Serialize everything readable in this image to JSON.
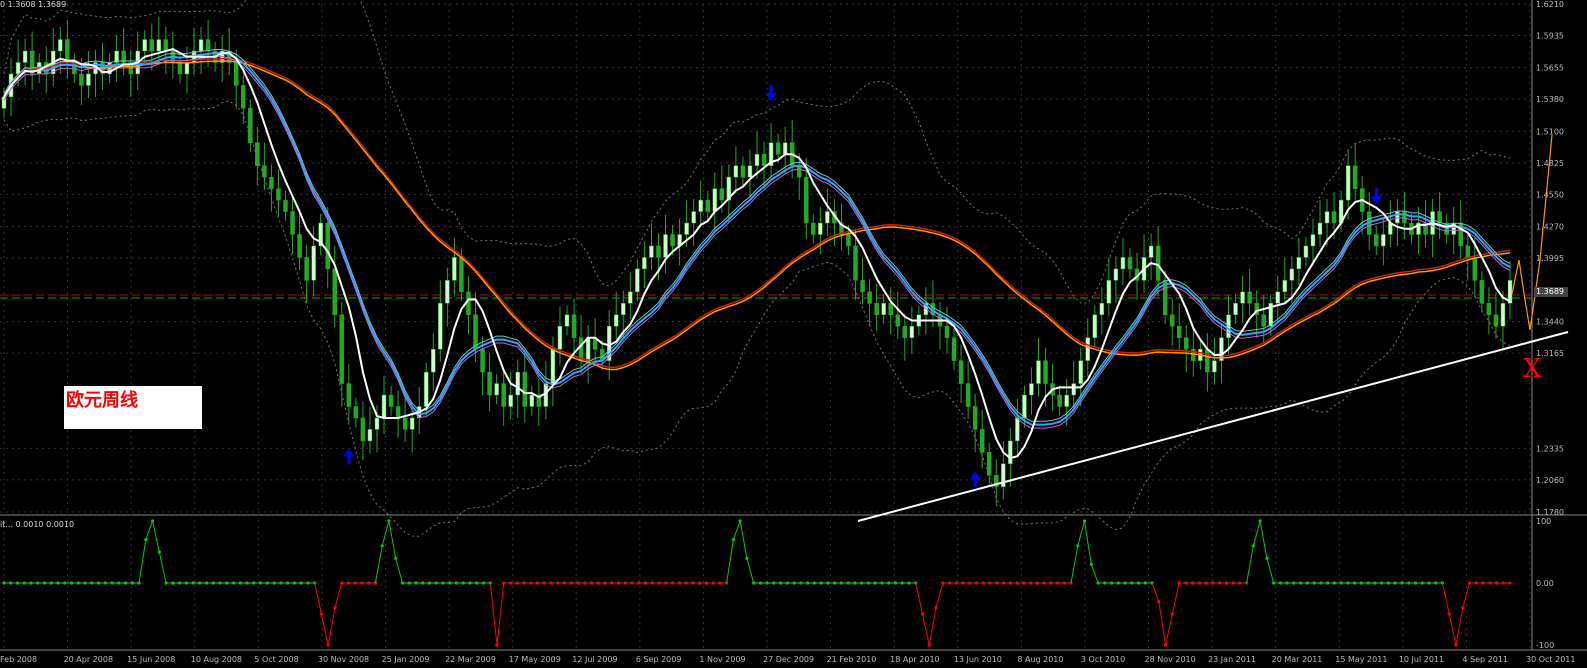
{
  "main_info": "0 1.3608 1.3689",
  "sub_info": "it... 0.0010 0.0010",
  "annotation_label": "欧元周线",
  "reversal_mark": "X",
  "current_price": "1.3689",
  "colors": {
    "background": "#000000",
    "candle_up": "#ccffcc",
    "candle_down": "#22aa22",
    "white_line": "#ffffff",
    "blue_line": "#3aa0ff",
    "orange_line": "#ff9900",
    "red_line": "#cc2200",
    "magenta_line": "#cc66cc",
    "cyan_line": "#66cccc",
    "arrow": "#0000ff",
    "osc_green": "#00cc00",
    "osc_red": "#ff0000"
  },
  "chart_data": [
    {
      "type": "candlestick",
      "title": "",
      "y_axis_ticks": [
        "1.6210",
        "1.5935",
        "1.5655",
        "1.5380",
        "1.5100",
        "1.4825",
        "1.4550",
        "1.4270",
        "1.3995",
        "1.3440",
        "1.3165",
        "1.2335",
        "1.2060",
        "1.1780"
      ],
      "ylim": [
        1.178,
        1.621
      ],
      "x_axis_ticks": [
        "Feb 2008",
        "20 Apr 2008",
        "15 Jun 2008",
        "10 Aug 2008",
        "5 Oct 2008",
        "30 Nov 2008",
        "25 Jan 2009",
        "22 Mar 2009",
        "17 May 2009",
        "12 Jul 2009",
        "6 Sep 2009",
        "1 Nov 2009",
        "27 Dec 2009",
        "21 Feb 2010",
        "18 Apr 2010",
        "13 Jun 2010",
        "8 Aug 2010",
        "3 Oct 2010",
        "28 Nov 2010",
        "23 Jan 2011",
        "20 Mar 2011",
        "15 May 2011",
        "10 Jul 2011",
        "4 Sep 2011",
        "30 Oct 2011"
      ],
      "price_series": [
        1.54,
        1.56,
        1.57,
        1.58,
        1.56,
        1.57,
        1.56,
        1.58,
        1.59,
        1.57,
        1.56,
        1.55,
        1.56,
        1.57,
        1.56,
        1.57,
        1.58,
        1.57,
        1.56,
        1.58,
        1.59,
        1.58,
        1.59,
        1.58,
        1.57,
        1.56,
        1.57,
        1.58,
        1.59,
        1.58,
        1.57,
        1.58,
        1.57,
        1.55,
        1.53,
        1.5,
        1.48,
        1.47,
        1.46,
        1.45,
        1.44,
        1.42,
        1.4,
        1.38,
        1.41,
        1.43,
        1.39,
        1.35,
        1.29,
        1.27,
        1.26,
        1.24,
        1.25,
        1.26,
        1.28,
        1.27,
        1.26,
        1.25,
        1.26,
        1.27,
        1.3,
        1.32,
        1.36,
        1.38,
        1.4,
        1.37,
        1.35,
        1.32,
        1.3,
        1.28,
        1.29,
        1.27,
        1.28,
        1.3,
        1.27,
        1.28,
        1.27,
        1.29,
        1.32,
        1.34,
        1.35,
        1.33,
        1.31,
        1.33,
        1.32,
        1.31,
        1.34,
        1.35,
        1.36,
        1.37,
        1.39,
        1.4,
        1.41,
        1.4,
        1.42,
        1.41,
        1.42,
        1.43,
        1.44,
        1.45,
        1.44,
        1.46,
        1.45,
        1.47,
        1.48,
        1.47,
        1.48,
        1.49,
        1.48,
        1.5,
        1.49,
        1.5,
        1.48,
        1.47,
        1.43,
        1.42,
        1.43,
        1.44,
        1.43,
        1.42,
        1.41,
        1.38,
        1.37,
        1.36,
        1.35,
        1.36,
        1.35,
        1.34,
        1.33,
        1.34,
        1.35,
        1.36,
        1.35,
        1.34,
        1.33,
        1.31,
        1.29,
        1.27,
        1.25,
        1.23,
        1.21,
        1.2,
        1.22,
        1.24,
        1.26,
        1.28,
        1.29,
        1.31,
        1.29,
        1.28,
        1.27,
        1.28,
        1.29,
        1.31,
        1.33,
        1.35,
        1.36,
        1.38,
        1.39,
        1.4,
        1.39,
        1.38,
        1.4,
        1.41,
        1.38,
        1.35,
        1.34,
        1.33,
        1.32,
        1.31,
        1.32,
        1.3,
        1.31,
        1.33,
        1.35,
        1.36,
        1.37,
        1.36,
        1.35,
        1.34,
        1.36,
        1.37,
        1.38,
        1.39,
        1.4,
        1.41,
        1.42,
        1.43,
        1.44,
        1.43,
        1.45,
        1.48,
        1.46,
        1.44,
        1.42,
        1.41,
        1.42,
        1.43,
        1.44,
        1.43,
        1.42,
        1.43,
        1.42,
        1.44,
        1.43,
        1.42,
        1.43,
        1.41,
        1.4,
        1.38,
        1.36,
        1.35,
        1.34,
        1.36,
        1.38
      ],
      "arrows_down_at_index": [
        22,
        109,
        195
      ],
      "arrows_up_at_index": [
        49,
        138,
        222
      ]
    },
    {
      "type": "line",
      "title": "",
      "y_axis_ticks": [
        "100",
        "0.00",
        "-100"
      ],
      "ylim": [
        -100,
        100
      ],
      "oscillator_series": [
        0,
        0,
        0,
        0,
        0,
        0,
        0,
        0,
        0,
        0,
        0,
        0,
        0,
        0,
        0,
        0,
        0,
        0,
        0,
        0,
        0,
        70,
        100,
        50,
        0,
        0,
        0,
        0,
        0,
        0,
        0,
        0,
        0,
        0,
        0,
        0,
        0,
        0,
        0,
        0,
        0,
        0,
        0,
        0,
        0,
        0,
        0,
        -50,
        -100,
        -40,
        0,
        0,
        0,
        0,
        0,
        0,
        60,
        100,
        40,
        0,
        0,
        0,
        0,
        0,
        0,
        0,
        0,
        0,
        0,
        0,
        0,
        0,
        0,
        -100,
        0,
        0,
        0,
        0,
        0,
        0,
        0,
        0,
        0,
        0,
        0,
        0,
        0,
        0,
        0,
        0,
        0,
        0,
        0,
        0,
        0,
        0,
        0,
        0,
        0,
        0,
        0,
        0,
        0,
        0,
        0,
        0,
        0,
        0,
        70,
        100,
        40,
        0,
        0,
        0,
        0,
        0,
        0,
        0,
        0,
        0,
        0,
        0,
        0,
        0,
        0,
        0,
        0,
        0,
        0,
        0,
        0,
        0,
        0,
        0,
        0,
        0,
        -50,
        -100,
        -40,
        0,
        0,
        0,
        0,
        0,
        0,
        0,
        0,
        0,
        0,
        0,
        0,
        0,
        0,
        0,
        0,
        0,
        0,
        0,
        0,
        60,
        100,
        30,
        0,
        0,
        0,
        0,
        0,
        0,
        0,
        0,
        0,
        -30,
        -100,
        -50,
        0,
        0,
        0,
        0,
        0,
        0,
        0,
        0,
        0,
        0,
        0,
        60,
        100,
        40,
        0,
        0,
        0,
        0,
        0,
        0,
        0,
        0,
        0,
        0,
        0,
        0,
        0,
        0,
        0,
        0,
        0,
        0,
        0,
        0,
        0,
        0,
        0,
        0,
        0,
        0,
        -50,
        -100,
        -40,
        0,
        0,
        0,
        0,
        0,
        0,
        0
      ]
    }
  ]
}
